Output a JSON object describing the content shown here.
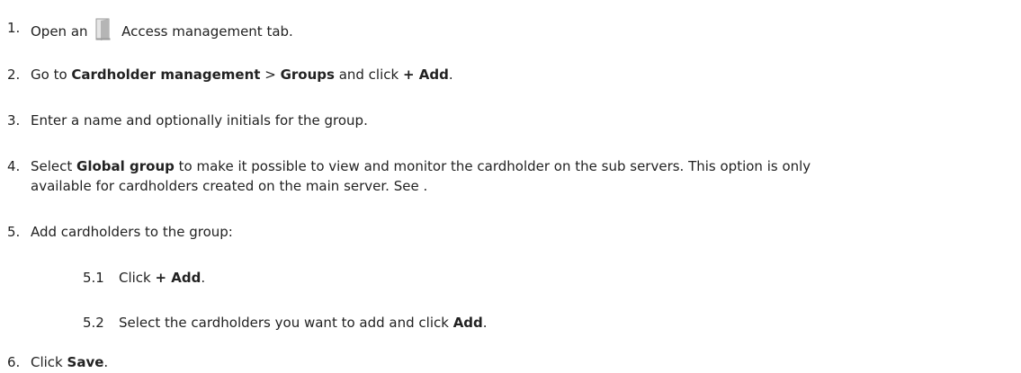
{
  "steps": [
    {
      "number": "1.",
      "pre": "Open an",
      "icon": "door-icon",
      "post": "Access management tab."
    },
    {
      "number": "2.",
      "pre": "Go to ",
      "b1": "Cardholder management",
      "mid1": " > ",
      "b2": "Groups",
      "mid2": " and click ",
      "b3": "+ Add",
      "post": "."
    },
    {
      "number": "3.",
      "text": "Enter a name and optionally initials for the group."
    },
    {
      "number": "4.",
      "pre": "Select ",
      "b1": "Global group",
      "line1_post": " to make it possible to view and monitor the cardholder on the sub servers. This option is only",
      "line2": "available for cardholders created on the main server. See ."
    },
    {
      "number": "5.",
      "text": "Add cardholders to the group:",
      "substeps": [
        {
          "number": "5.1",
          "pre": "Click ",
          "b1": "+ Add",
          "post": "."
        },
        {
          "number": "5.2",
          "pre": "Select the cardholders you want to add and click ",
          "b1": "Add",
          "post": "."
        }
      ]
    },
    {
      "number": "6.",
      "pre": "Click ",
      "b1": "Save",
      "post": "."
    }
  ]
}
